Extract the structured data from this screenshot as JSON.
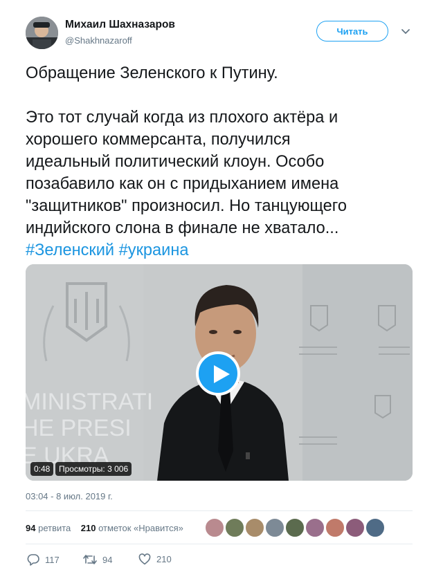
{
  "author": {
    "name": "Михаил Шахназаров",
    "handle": "@Shakhnazaroff",
    "avatar_icon": "user-avatar-icon"
  },
  "follow_button": {
    "label": "Читать"
  },
  "caret_icon": "chevron-down-icon",
  "tweet": {
    "line1": "Обращение Зеленского к Путину.",
    "line2": "Это тот случай когда из плохого актёра и",
    "line3": "хорошего коммерсанта, получился",
    "line4": "идеальный политический клоун. Особо",
    "line5": "позабавило как он с придыханием имена",
    "line6": "\"защитников\" произносил. Но танцующего",
    "line7": "индийского слона в финале не хватало...",
    "hashtag1": "#Зеленский",
    "hashtag2": "#украина"
  },
  "video": {
    "duration": "0:48",
    "views": "Просмотры: 3 006",
    "play_icon": "play-icon",
    "background_text_1": "MINISTRATI",
    "background_text_2": "HE PRESI",
    "background_text_3": "E UKRA"
  },
  "timestamp": "03:04 - 8 июл. 2019 г.",
  "stats": {
    "retweets_count": "94",
    "retweets_label": "ретвита",
    "likes_count": "210",
    "likes_label": "отметок «Нравится»"
  },
  "actions": {
    "replies": "117",
    "retweets": "94",
    "likes": "210"
  },
  "colors": {
    "accent": "#1da1f2",
    "hashtag": "#1b95e0",
    "muted": "#657786"
  }
}
